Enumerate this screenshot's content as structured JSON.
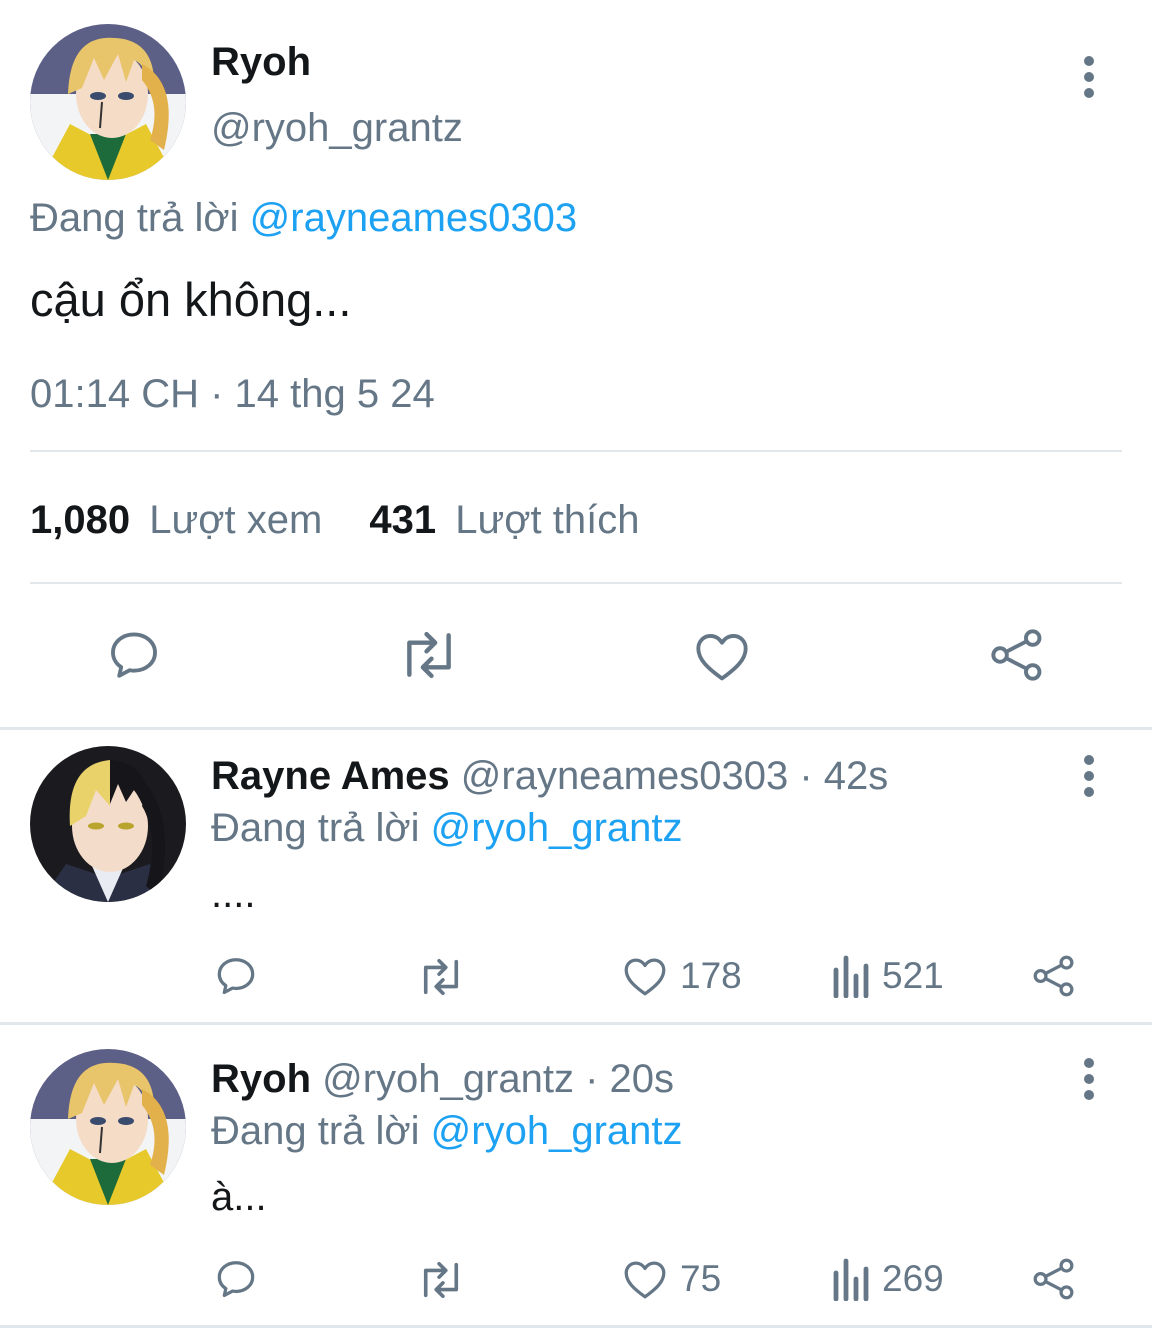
{
  "main_tweet": {
    "display_name": "Ryoh",
    "handle": "@ryoh_grantz",
    "replying_prefix": "Đang trả lời",
    "replying_to": "@rayneames0303",
    "text": "cậu ổn không...",
    "timestamp": "01:14 CH · 14 thg 5 24",
    "views_count": "1,080",
    "views_label": "Lượt xem",
    "likes_count": "431",
    "likes_label": "Lượt thích"
  },
  "replies": [
    {
      "display_name": "Rayne Ames",
      "handle": "@rayneames0303",
      "age": "· 42s",
      "replying_prefix": "Đang trả lời",
      "replying_to": "@ryoh_grantz",
      "text": "....",
      "like_count": "178",
      "view_count": "521"
    },
    {
      "display_name": "Ryoh",
      "handle": "@ryoh_grantz",
      "age": "· 20s",
      "replying_prefix": "Đang trả lời",
      "replying_to": "@ryoh_grantz",
      "text": "à...",
      "like_count": "75",
      "view_count": "269"
    }
  ],
  "icons": [
    "reply-icon",
    "retweet-icon",
    "like-icon",
    "share-icon",
    "views-icon",
    "more-icon"
  ],
  "colors": {
    "link": "#1da1f2",
    "muted": "#657786",
    "divider": "#e1e8ed",
    "text": "#14171a"
  }
}
